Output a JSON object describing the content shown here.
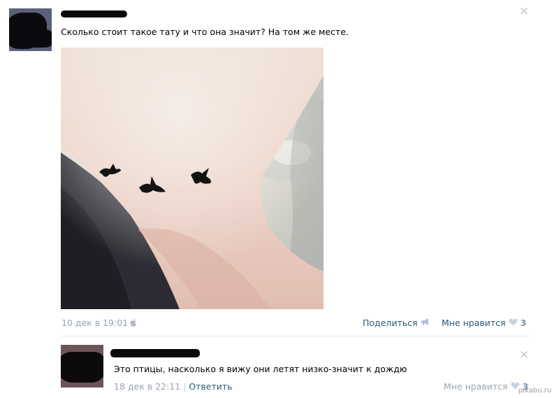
{
  "post": {
    "text": "Сколько стоит такое тату и что она значит? На том же месте.",
    "date": "10 дек в 19:01",
    "share_label": "Поделиться",
    "like_label": "Мне нравится",
    "like_count": "3"
  },
  "comment": {
    "text": "Это птицы, насколько я вижу они летят низко-значит к дождю",
    "date": "18 дек в 22:11",
    "separator": "|",
    "reply_label": "Ответить",
    "like_label": "Мне нравится",
    "like_count": "3"
  },
  "watermark": "pikabu.ru",
  "icons": {
    "close": "close-icon",
    "share": "megaphone-icon",
    "like": "heart-icon",
    "device": "apple-icon"
  },
  "colors": {
    "link": "#2b587a",
    "muted": "#9aa3ae",
    "like_count": "#7d94b0"
  }
}
